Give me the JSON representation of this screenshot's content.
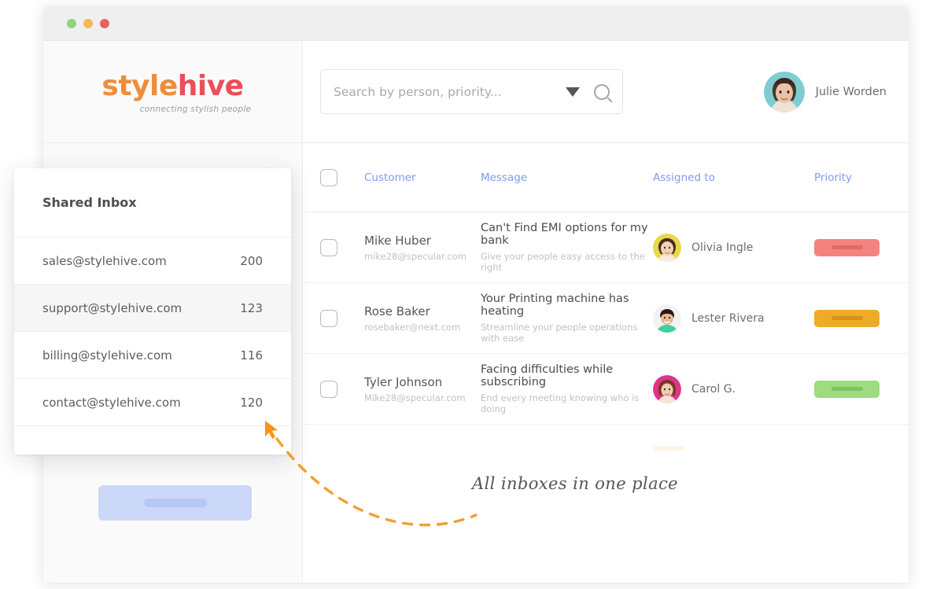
{
  "window": {
    "dots": [
      "green",
      "orange",
      "red"
    ]
  },
  "brand": {
    "name_part1": "style",
    "name_part2": "hive",
    "tagline": "connecting stylish people",
    "color1": "#f08c3a",
    "color2": "#ea4f5a"
  },
  "search": {
    "placeholder": "Search by person, priority...",
    "value": "",
    "dropdown_icon": "filled-triangle-down-icon",
    "search_icon": "magnifier-icon"
  },
  "user": {
    "name": "Julie Worden",
    "avatar_bg": "#7fcdd2"
  },
  "sidebar": {
    "placeholder_button": {
      "bg": "#ccd8f8",
      "bar": "#b7c8f6"
    }
  },
  "inbox_panel": {
    "title": "Shared Inbox",
    "items": [
      {
        "email": "sales@stylehive.com",
        "count": "200",
        "active": false
      },
      {
        "email": "support@stylehive.com",
        "count": "123",
        "active": true
      },
      {
        "email": "billing@stylehive.com",
        "count": "116",
        "active": false
      },
      {
        "email": "contact@stylehive.com",
        "count": "120",
        "active": false
      }
    ]
  },
  "table": {
    "headers": {
      "customer": "Customer",
      "message": "Message",
      "assigned": "Assigned to",
      "priority": "Priority"
    },
    "header_color": "#7e9bf0",
    "rows": [
      {
        "customer_name": "Mike Huber",
        "customer_email": "mike28@specular.com",
        "message_title": "Can't Find EMI options for my bank",
        "message_sub": "Give your people easy access to the right",
        "assignee": "Olivia Ingle",
        "assignee_avatar_bg": "#e8d84b",
        "priority_color": "#f4837f",
        "priority_bar_color": "#e06a68"
      },
      {
        "customer_name": "Rose Baker",
        "customer_email": "rosebaker@next.com",
        "message_title": "Your Printing machine has heating",
        "message_sub": "Streamline your people operations with ease",
        "assignee": "Lester Rivera",
        "assignee_avatar_bg": "#3fd0a0",
        "priority_color": "#eeab2a",
        "priority_bar_color": "#d4921a"
      },
      {
        "customer_name": "Tyler Johnson",
        "customer_email": "Mike28@specular.com",
        "message_title": "Facing difficulties while subscribing",
        "message_sub": "End every meeting knowing who is doing",
        "assignee": "Carol G.",
        "assignee_avatar_bg": "#e0348a",
        "priority_color": "#9fdb80",
        "priority_bar_color": "#7cc45c"
      }
    ]
  },
  "annotation": {
    "text": "All inboxes in one place",
    "arrow_color": "#f0a030",
    "cursor_icon": "cursor-arrow-icon"
  }
}
